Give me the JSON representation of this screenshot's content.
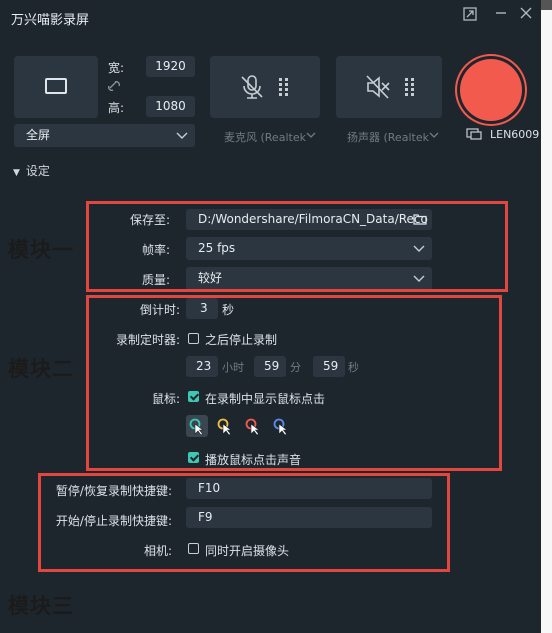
{
  "window": {
    "title": "万兴喵影录屏"
  },
  "capture": {
    "width_label": "宽:",
    "width_value": "1920",
    "height_label": "高:",
    "height_value": "1080",
    "area_select": "全屏"
  },
  "audio": {
    "mic_label": "麦克风 (Realtek",
    "speaker_label": "扬声器 (Realtek",
    "monitor_label": "LEN6009"
  },
  "settings": {
    "section_label": "设定",
    "save_label": "保存至:",
    "save_path": "D:/Wondershare/FilmoraCN_Data/Reco",
    "fps_label": "帧率:",
    "fps_value": "25 fps",
    "quality_label": "质量:",
    "quality_value": "较好",
    "countdown_label": "倒计时:",
    "countdown_value": "3",
    "countdown_unit": "秒",
    "timer_label": "录制定时器:",
    "timer_checkbox": "之后停止录制",
    "timer_hours": "23",
    "timer_hours_unit": "小时",
    "timer_minutes": "59",
    "timer_minutes_unit": "分",
    "timer_seconds": "59",
    "timer_seconds_unit": "秒",
    "mouse_label": "鼠标:",
    "mouse_show_clicks": "在录制中显示鼠标点击",
    "mouse_sound": "播放鼠标点击声音",
    "pause_hotkey_label": "暂停/恢复录制快捷键:",
    "pause_hotkey_value": "F10",
    "start_hotkey_label": "开始/停止录制快捷键:",
    "start_hotkey_value": "F9",
    "camera_label": "相机:",
    "camera_checkbox": "同时开启摄像头"
  },
  "annotations": {
    "module1": "模块一",
    "module2": "模块二",
    "module3": "模块三"
  },
  "colors": {
    "accent": "#3ec8b4",
    "record": "#f25a4e",
    "highlight_box": "#e2463f",
    "cursor_colors": [
      "#3ec8b4",
      "#f0c040",
      "#f25a4e",
      "#5a8cf0"
    ]
  }
}
